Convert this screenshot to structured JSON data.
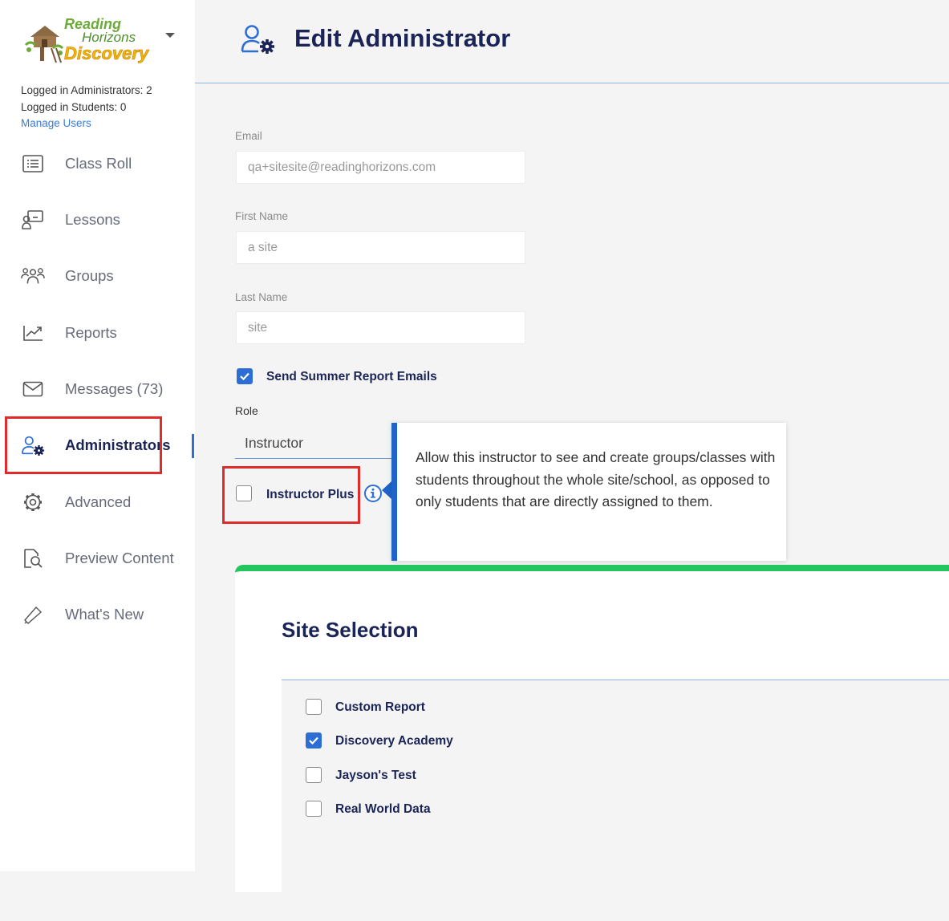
{
  "sidebar": {
    "logo": {
      "line1": "Reading",
      "line2": "Horizons",
      "line3": "Discovery"
    },
    "stats": {
      "admins": "Logged in Administrators: 2",
      "students": "Logged in Students: 0",
      "manage_link": "Manage Users"
    },
    "items": [
      {
        "label": "Class Roll",
        "icon": "class-roll-icon"
      },
      {
        "label": "Lessons",
        "icon": "lessons-icon"
      },
      {
        "label": "Groups",
        "icon": "groups-icon"
      },
      {
        "label": "Reports",
        "icon": "reports-icon"
      },
      {
        "label": "Messages (73)",
        "icon": "messages-icon"
      },
      {
        "label": "Administrators",
        "icon": "administrators-icon",
        "active": true
      },
      {
        "label": "Advanced",
        "icon": "gear-icon"
      },
      {
        "label": "Preview Content",
        "icon": "preview-icon"
      },
      {
        "label": "What's New",
        "icon": "megaphone-icon"
      }
    ]
  },
  "header": {
    "title": "Edit Administrator",
    "icon": "user-gear-icon"
  },
  "form": {
    "email": {
      "label": "Email",
      "value": "qa+sitesite@readinghorizons.com"
    },
    "first_name": {
      "label": "First Name",
      "value": "a site"
    },
    "last_name": {
      "label": "Last Name",
      "value": "site"
    },
    "summer_emails": {
      "label": "Send Summer Report Emails",
      "checked": true
    },
    "role": {
      "label": "Role",
      "value": "Instructor"
    },
    "instructor_plus": {
      "label": "Instructor Plus",
      "checked": false
    }
  },
  "tooltip": {
    "text": "Allow this instructor to see and create groups/classes with students throughout the whole site/school, as opposed to only students that are directly assigned to them."
  },
  "site_selection": {
    "title": "Site Selection",
    "sites": [
      {
        "label": "Custom Report",
        "checked": false
      },
      {
        "label": "Discovery Academy",
        "checked": true
      },
      {
        "label": "Jayson's Test",
        "checked": false
      },
      {
        "label": "Real World Data",
        "checked": false
      }
    ]
  },
  "colors": {
    "accent": "#2d6ed6",
    "navy": "#1b2456",
    "highlight": "#e12b2b",
    "card_top": "#22c55e"
  }
}
